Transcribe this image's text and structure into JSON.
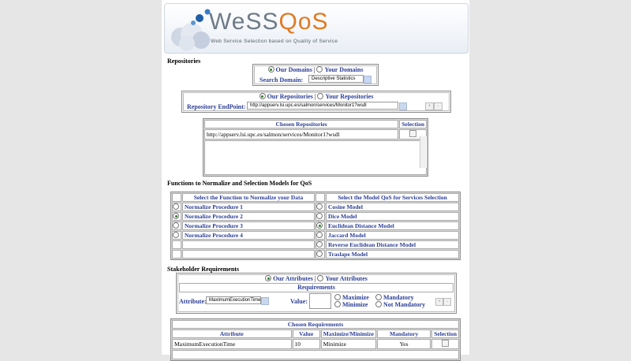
{
  "logo": {
    "title_prefix": "WeSS",
    "title_accent": "QoS",
    "subtitle": "Web Service Selection based on Quality of Service"
  },
  "repositories": {
    "heading": "Repositories",
    "domains": {
      "our_label": "Our Domains",
      "separator": "|",
      "your_label": "Your Domains",
      "search_label": "Search Domain:",
      "search_value": "Descriptive Statistics"
    },
    "repos": {
      "our_label": "Our Repositories",
      "separator": "|",
      "your_label": "Your Repositories",
      "endpoint_label": "Repository EndPoint:",
      "endpoint_value": "http://appserv.lsi.upc.es/salmon/services/Monitor1?wsdl",
      "add": "+",
      "remove": "-"
    },
    "chosen": {
      "header": "Chosen Repositories",
      "selection_header": "Selection",
      "rows": [
        "http://appserv.lsi.upc.es/salmon/services/Monitor1?wsdl"
      ]
    }
  },
  "functions": {
    "heading": "Functions to Normalize and Selection Models for QoS",
    "normalize_header": "Select the Function to Normalize your Data",
    "model_header": "Select the Model QoS for Services Selection",
    "normalize_items": [
      "Normalize Procedure 1",
      "Normalize Procedure 2",
      "Normalize Procedure 3",
      "Normalize Procedure 4",
      "",
      ""
    ],
    "model_items": [
      "Cosine Model",
      "Dice Model",
      "Euclidean Distance Model",
      "Jaccard Model",
      "Reverse Euclidean Distance Model",
      "Traslape Model"
    ]
  },
  "stakeholder": {
    "heading": "Stakeholder Requirements",
    "our_label": "Our Attributes",
    "separator": "|",
    "your_label": "Your Attributes",
    "requirements_header": "Requirements",
    "attribute_label": "Attribute:",
    "attribute_value": "MaximumExecutionTime",
    "value_label": "Value:",
    "maximize": "Maximize",
    "minimize": "Minimize",
    "mandatory": "Mandatory",
    "not_mandatory": "Not Mandatory",
    "add": "+",
    "remove": "-"
  },
  "chosen_requirements": {
    "header": "Chosen Requirements",
    "columns": [
      "Attribute",
      "Value",
      "Maximize/Minimize",
      "Mandatory",
      "Selection"
    ],
    "rows": [
      {
        "attribute": "MaximumExecutionTime",
        "value": "10",
        "direction": "Minimize",
        "mandatory": "Yes"
      }
    ]
  }
}
